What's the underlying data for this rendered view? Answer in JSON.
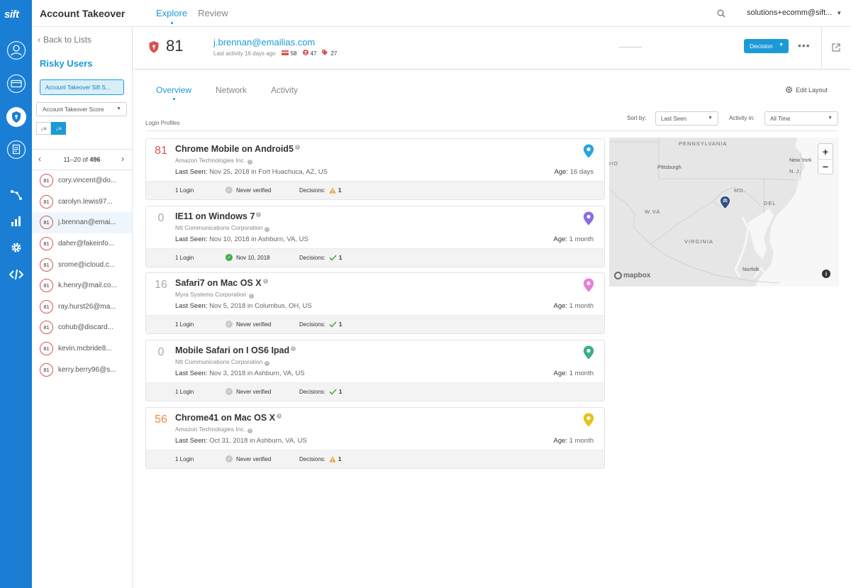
{
  "brand": {
    "logo": "sift",
    "accent": "#1a9ad6",
    "rail_color": "#1a7fd4"
  },
  "app_title": "Account Takeover",
  "top_nav": {
    "tabs": [
      {
        "label": "Explore"
      },
      {
        "label": "Review"
      }
    ],
    "user": "solutions+ecomm@sift..."
  },
  "rail_icons": [
    "user-circle-icon",
    "card-icon",
    "shield-lock-icon",
    "document-icon",
    "network-icon",
    "bar-chart-icon",
    "gear-icon",
    "code-icon"
  ],
  "sidebar": {
    "back_label": "Back to Lists",
    "list_title": "Risky Users",
    "list_button": "Account Takeover Sift S...",
    "score_select": "Account Takeover Score",
    "pager": {
      "range": "11–20",
      "of": "of",
      "total": "496"
    },
    "users": [
      {
        "score": "81",
        "email": "cory.vincent@do..."
      },
      {
        "score": "81",
        "email": "carolyn.lewis97..."
      },
      {
        "score": "81",
        "email": "j.brennan@emai..."
      },
      {
        "score": "81",
        "email": "daher@fakeinfo..."
      },
      {
        "score": "81",
        "email": "srome@icloud.c..."
      },
      {
        "score": "81",
        "email": "k.henry@mail.co..."
      },
      {
        "score": "81",
        "email": "ray.hurst26@ma..."
      },
      {
        "score": "81",
        "email": "cohub@discard..."
      },
      {
        "score": "81",
        "email": "kevin.mcbride8..."
      },
      {
        "score": "81",
        "email": "kerry.berry96@s..."
      }
    ]
  },
  "user_header": {
    "score": "81",
    "email": "j.brennan@emailias.com",
    "last_activity": "Last activity 16 days ago",
    "meta": [
      {
        "icon": "payment-icon",
        "value": "58"
      },
      {
        "icon": "person-icon",
        "value": "47"
      },
      {
        "icon": "tag-icon",
        "value": "27"
      }
    ],
    "decision_label": "Decision"
  },
  "content_tabs": [
    {
      "label": "Overview"
    },
    {
      "label": "Network"
    },
    {
      "label": "Activity"
    }
  ],
  "edit_layout": "Edit Layout",
  "login_profiles": {
    "section_label": "Login Profiles",
    "sort_by_label": "Sort by:",
    "sort_by_value": "Last Seen",
    "activity_in_label": "Activity in:",
    "activity_in_value": "All Time",
    "last_seen_label": "Last Seen:",
    "age_label": "Age:",
    "decisions_label": "Decisions:",
    "profiles": [
      {
        "score": "81",
        "score_color": "#d9534f",
        "device": "Chrome Mobile on Android5",
        "org": "Amazon Technologies Inc.",
        "last_seen": "Nov 25, 2018 in Fort Huachuca, AZ, US",
        "age": "16 days",
        "logins": "1 Login",
        "verified": "Never verified",
        "verified_state": "none",
        "decision_icon": "warning",
        "decision_count": "1",
        "pin_color": "#2aa5dc"
      },
      {
        "score": "0",
        "score_color": "#aaaaaa",
        "device": "IE11 on Windows 7",
        "org": "Ntt Communications Corporation",
        "last_seen": "Nov 10, 2018 in Ashburn, VA, US",
        "age": "1 month",
        "logins": "1 Login",
        "verified": "Nov 10, 2018",
        "verified_state": "ok",
        "decision_icon": "check",
        "decision_count": "1",
        "pin_color": "#8d6be8"
      },
      {
        "score": "16",
        "score_color": "#aaaaaa",
        "device": "Safari7 on Mac OS X",
        "org": "Myra Systems Corporation",
        "last_seen": "Nov 5, 2018 in Columbus, OH, US",
        "age": "1 month",
        "logins": "1 Login",
        "verified": "Never verified",
        "verified_state": "none",
        "decision_icon": "check",
        "decision_count": "1",
        "pin_color": "#e87ed8"
      },
      {
        "score": "0",
        "score_color": "#aaaaaa",
        "device": "Mobile Safari on I OS6 Ipad",
        "org": "Ntt Communications Corporation",
        "last_seen": "Nov 3, 2018 in Ashburn, VA, US",
        "age": "1 month",
        "logins": "1 Login",
        "verified": "Never verified",
        "verified_state": "none",
        "decision_icon": "check",
        "decision_count": "1",
        "pin_color": "#3aae8f"
      },
      {
        "score": "56",
        "score_color": "#f0883e",
        "device": "Chrome41 on Mac OS X",
        "org": "Amazon Technologies Inc.",
        "last_seen": "Oct 31, 2018 in Ashburn, VA, US",
        "age": "1 month",
        "logins": "1 Login",
        "verified": "Never verified",
        "verified_state": "none",
        "decision_icon": "warning",
        "decision_count": "1",
        "pin_color": "#e6c21a"
      }
    ]
  },
  "map": {
    "labels": {
      "pennsylvania": "PENNSYLVANIA",
      "virginia": "VIRGINIA",
      "wva": "W.VA",
      "md": "MD.",
      "del": "DEL",
      "nj": "N.J.",
      "ohio": "IIO"
    },
    "cities": {
      "pittsburgh": "Pittsburgh",
      "new_york": "New York",
      "norfolk": "Norfolk"
    },
    "attribution": "mapbox"
  }
}
